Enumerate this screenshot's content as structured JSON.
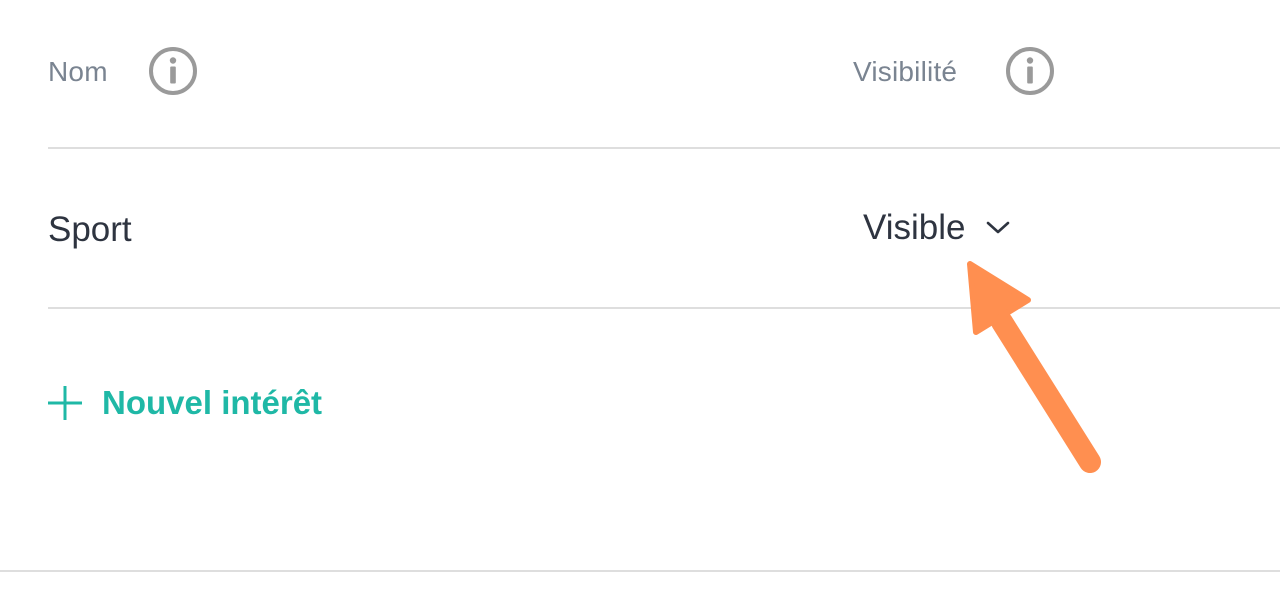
{
  "table": {
    "columns": [
      {
        "label": "Nom",
        "icon": "info-icon"
      },
      {
        "label": "Visibilité",
        "icon": "info-icon"
      }
    ],
    "rows": [
      {
        "name": "Sport",
        "visibility": "Visible"
      }
    ]
  },
  "actions": {
    "add_label": "Nouvel intérêt",
    "add_icon": "plus-icon"
  },
  "colors": {
    "accent": "#1fb8a6",
    "annotation_arrow": "#ff8f50",
    "header_text": "#7a8491",
    "body_text": "#2e3440",
    "divider": "#dedede",
    "icon_gray": "#9a9a9a"
  }
}
